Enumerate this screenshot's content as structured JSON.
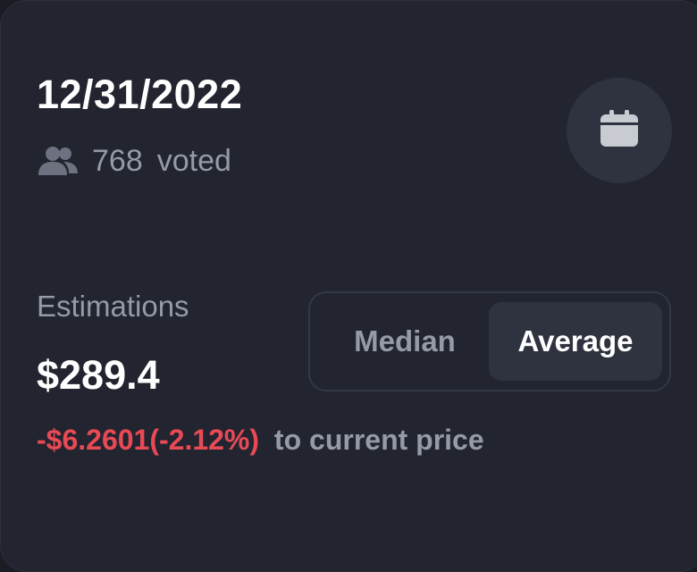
{
  "header": {
    "date": "12/31/2022",
    "vote_count": "768",
    "voted_label": "voted",
    "people_icon": "people-icon",
    "calendar_icon": "calendar-icon"
  },
  "estimations": {
    "label": "Estimations",
    "value": "$289.4",
    "diff": "-$6.2601(-2.12%)",
    "diff_suffix": "to current price"
  },
  "toggle": {
    "options": [
      "Median",
      "Average"
    ],
    "selected": "Average"
  },
  "colors": {
    "card_background": "#22242f",
    "muted_text": "#9699a6",
    "negative": "#e84a55",
    "selected_option_bg": "#2f323f"
  }
}
